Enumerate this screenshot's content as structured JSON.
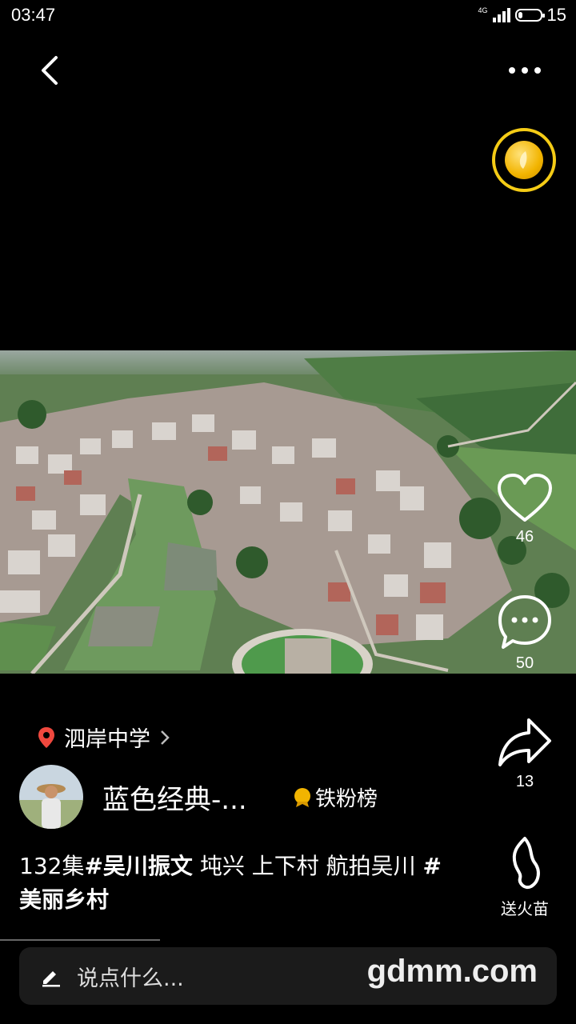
{
  "status_bar": {
    "time": "03:47",
    "network": "4G",
    "battery": "15"
  },
  "video_area": {
    "coin_icon": "gold-coin-icon"
  },
  "actions": {
    "likes": "46",
    "comments": "50",
    "shares": "13",
    "gift_label": "送火苗"
  },
  "location": "泗岸中学",
  "author": {
    "name": "蓝色经典-...",
    "rank_label": "铁粉榜"
  },
  "caption": {
    "prefix": "132集",
    "tag1": "#吴川振文",
    "middle": " 坉兴 上下村 航拍吴川 ",
    "tag2": "#美丽乡村"
  },
  "comment_input": {
    "placeholder": "说点什么..."
  },
  "watermark": "gdmm.com",
  "colors": {
    "coin_ring": "#f5cc16",
    "location_pin": "#f0483e",
    "background": "#000000"
  }
}
